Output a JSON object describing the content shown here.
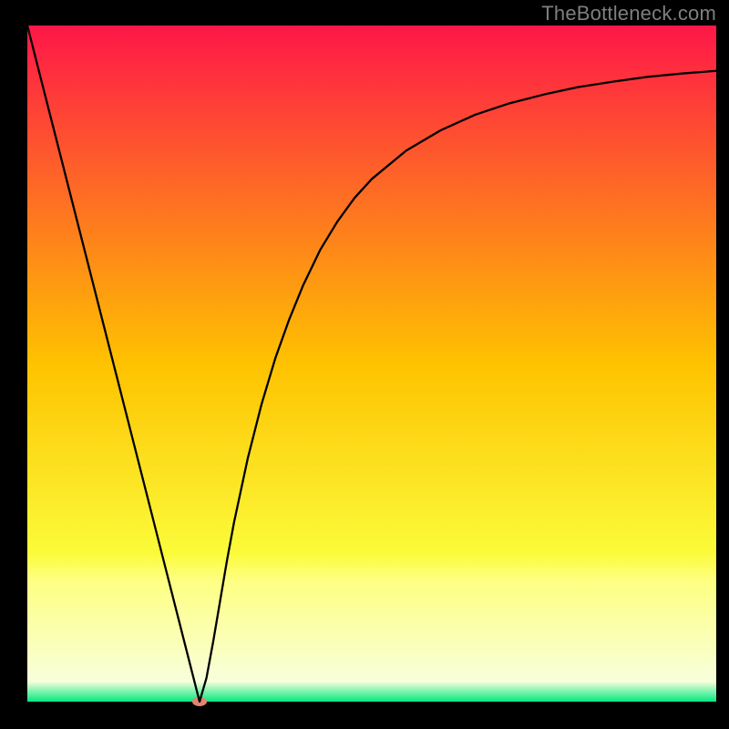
{
  "watermark": "TheBottleneck.com",
  "chart_data": {
    "type": "line",
    "title": "",
    "xlabel": "",
    "ylabel": "",
    "xlim": [
      0,
      100
    ],
    "ylim": [
      0,
      100
    ],
    "legend": false,
    "grid": false,
    "background_gradient": {
      "direction": "vertical",
      "stops": [
        {
          "offset": 0.0,
          "color": "#fe1748"
        },
        {
          "offset": 0.5,
          "color": "#fec200"
        },
        {
          "offset": 0.78,
          "color": "#fbfb3a"
        },
        {
          "offset": 0.82,
          "color": "#feff81"
        },
        {
          "offset": 0.97,
          "color": "#f8ffdb"
        },
        {
          "offset": 1.0,
          "color": "#02e880"
        }
      ]
    },
    "series": [
      {
        "name": "bottleneck-curve",
        "type": "line",
        "x": [
          0.0,
          2.0,
          4.0,
          6.0,
          8.0,
          10.0,
          12.0,
          14.0,
          16.0,
          18.0,
          20.0,
          22.0,
          24.0,
          25.0,
          26.0,
          27.0,
          28.0,
          29.0,
          30.0,
          32.0,
          34.0,
          36.0,
          38.0,
          40.0,
          42.5,
          45.0,
          47.5,
          50.0,
          55.0,
          60.0,
          65.0,
          70.0,
          75.0,
          80.0,
          85.0,
          90.0,
          95.0,
          100.0
        ],
        "values": [
          100.0,
          92.0,
          84.0,
          76.0,
          68.0,
          60.0,
          52.0,
          44.0,
          36.0,
          28.0,
          20.0,
          12.0,
          4.0,
          0.0,
          3.5,
          9.0,
          15.0,
          21.0,
          26.5,
          36.0,
          44.0,
          50.8,
          56.5,
          61.5,
          66.8,
          71.0,
          74.5,
          77.3,
          81.5,
          84.5,
          86.8,
          88.5,
          89.8,
          90.9,
          91.7,
          92.4,
          92.9,
          93.3
        ]
      }
    ],
    "marker": {
      "name": "optimal-point",
      "x": 25.0,
      "y": 0.0,
      "color": "#e3846f",
      "rx": 8,
      "ry": 5
    }
  }
}
